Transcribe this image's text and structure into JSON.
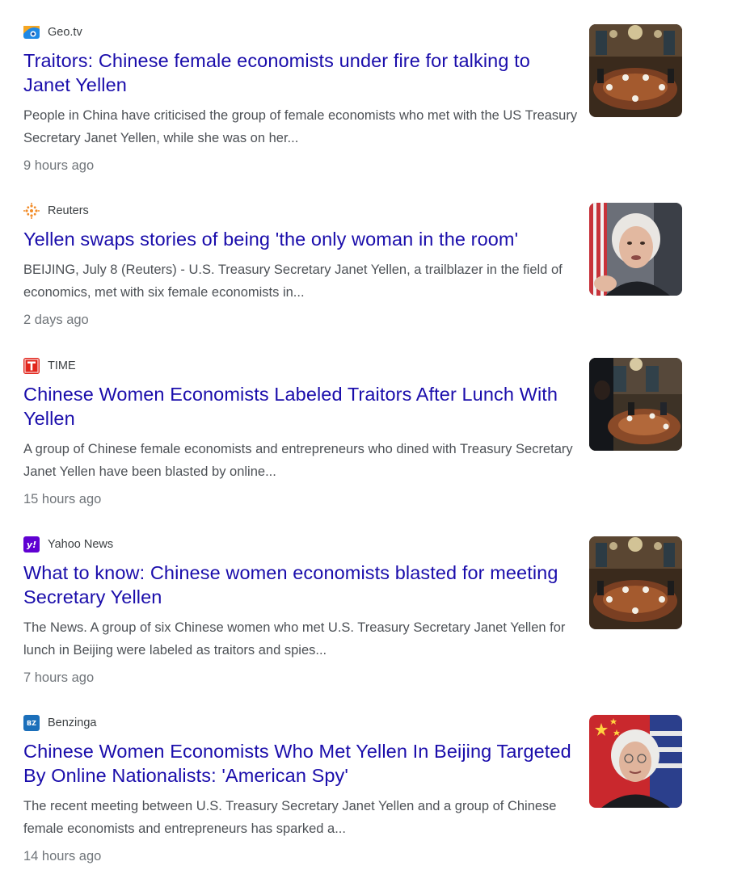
{
  "results": [
    {
      "source": "Geo.tv",
      "source_icon": "geo-tv-logo-icon",
      "title": "Traitors: Chinese female economists under fire for talking to Janet Yellen",
      "snippet": "People in China have criticised the group of female economists who met with the US Treasury Secretary Janet Yellen, while she was on her...",
      "time": "9 hours ago",
      "thumbnail": "banquet-dining-room-photo"
    },
    {
      "source": "Reuters",
      "source_icon": "reuters-logo-icon",
      "title": "Yellen swaps stories of being 'the only woman in the room'",
      "snippet": "BEIJING, July 8 (Reuters) - U.S. Treasury Secretary Janet Yellen, a trailblazer in the field of economics, met with six female economists in...",
      "time": "2 days ago",
      "thumbnail": "janet-yellen-portrait-photo"
    },
    {
      "source": "TIME",
      "source_icon": "time-logo-icon",
      "title": "Chinese Women Economists Labeled Traitors After Lunch With Yellen",
      "snippet": "A group of Chinese female economists and entrepreneurs who dined with Treasury Secretary Janet Yellen have been blasted by online...",
      "time": "15 hours ago",
      "thumbnail": "lunch-meeting-photo"
    },
    {
      "source": "Yahoo News",
      "source_icon": "yahoo-logo-icon",
      "title": "What to know: Chinese women economists blasted for meeting Secretary Yellen",
      "snippet": "The News. A group of six Chinese women who met U.S. Treasury Secretary Janet Yellen for lunch in Beijing were labeled as traitors and spies...",
      "time": "7 hours ago",
      "thumbnail": "banquet-dining-room-photo"
    },
    {
      "source": "Benzinga",
      "source_icon": "benzinga-logo-icon",
      "title": "Chinese Women Economists Who Met Yellen In Beijing Targeted By Online Nationalists: 'American Spy'",
      "snippet": "The recent meeting between U.S. Treasury Secretary Janet Yellen and a group of Chinese female economists and entrepreneurs has sparked a...",
      "time": "14 hours ago",
      "thumbnail": "yellen-with-flags-photo"
    }
  ],
  "logo_text": {
    "yahoo": "y!",
    "benzinga": "BZ"
  },
  "colors": {
    "title_link": "#1a0dab",
    "snippet": "#4d5156",
    "time": "#70757a",
    "source": "#3c4043"
  }
}
